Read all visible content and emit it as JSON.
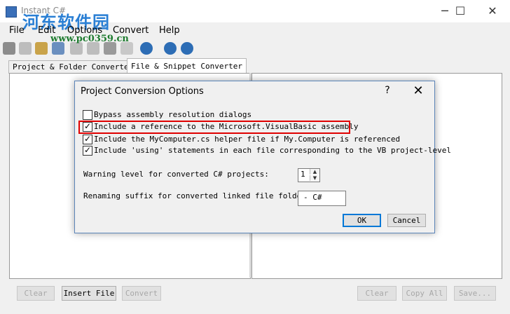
{
  "window": {
    "title": "Instant C#",
    "minimize": "─",
    "maximize": "☐",
    "close": "✕"
  },
  "watermark": {
    "text": "河东软件园",
    "url": "www.pc0359.cn"
  },
  "menu": [
    "File",
    "Edit",
    "Options",
    "Convert",
    "Help"
  ],
  "toolbar": {
    "icons": [
      "wrench-icon",
      "cut-icon",
      "paste-icon",
      "window-icon",
      "copy-icon",
      "edit-icon",
      "save-icon",
      "find-icon",
      "gear-icon",
      "help-icon",
      "refresh-icon"
    ]
  },
  "tabs": [
    {
      "label": "Project & Folder Converter"
    },
    {
      "label": "File & Snippet Converter"
    }
  ],
  "bottom_buttons": {
    "clear_left": "Clear",
    "insert_file": "Insert File",
    "convert": "Convert",
    "clear_right": "Clear",
    "copy_all": "Copy All",
    "save": "Save..."
  },
  "dialog": {
    "title": "Project Conversion Options",
    "help": "?",
    "close": "✕",
    "options": [
      {
        "label": "Bypass assembly resolution dialogs",
        "checked": false
      },
      {
        "label": "Include a reference to the Microsoft.VisualBasic assembly",
        "checked": true
      },
      {
        "label": "Include the MyComputer.cs helper file if My.Computer is referenced",
        "checked": true
      },
      {
        "label": "Include 'using' statements in each file corresponding to the VB project-level",
        "checked": true
      }
    ],
    "warning_label": "Warning level for converted C# projects:",
    "warning_value": "1",
    "suffix_label": "Renaming suffix for converted linked file folder",
    "suffix_value": "- C#",
    "ok": "OK",
    "cancel": "Cancel"
  },
  "colors": {
    "highlight": "#e00000",
    "accent": "#0078d7"
  }
}
